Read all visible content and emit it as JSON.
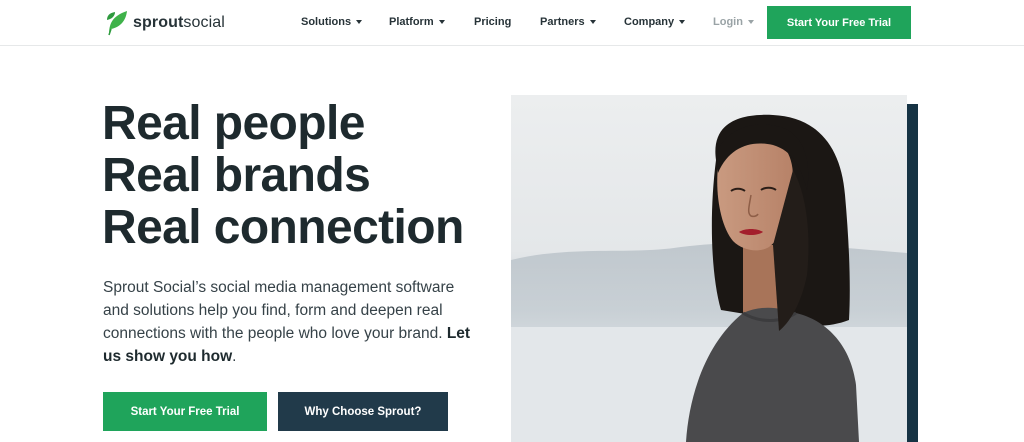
{
  "header": {
    "logo": {
      "text_bold": "sprout",
      "text_regular": "social",
      "icon": "sprout-leaf-logo"
    },
    "nav": [
      {
        "label": "Solutions",
        "has_dropdown": true
      },
      {
        "label": "Platform",
        "has_dropdown": true
      },
      {
        "label": "Pricing",
        "has_dropdown": false
      },
      {
        "label": "Partners",
        "has_dropdown": true
      },
      {
        "label": "Company",
        "has_dropdown": true
      },
      {
        "label": "Login",
        "has_dropdown": true
      }
    ],
    "cta_label": "Start Your Free Trial"
  },
  "hero": {
    "headline": [
      "Real people",
      "Real brands",
      "Real connection"
    ],
    "description": "Sprout Social’s social media management software and solutions help you find, form and deepen real connections with the people who love your brand.",
    "description_emphasis": "Let us show you how",
    "description_end": ".",
    "primary_button": "Start Your Free Trial",
    "secondary_button": "Why Choose Sprout?"
  },
  "colors": {
    "brand_green": "#1fa45b",
    "dark_navy": "#213a4a",
    "accent_bar": "#163344",
    "text_dark": "#1e2a2e"
  }
}
